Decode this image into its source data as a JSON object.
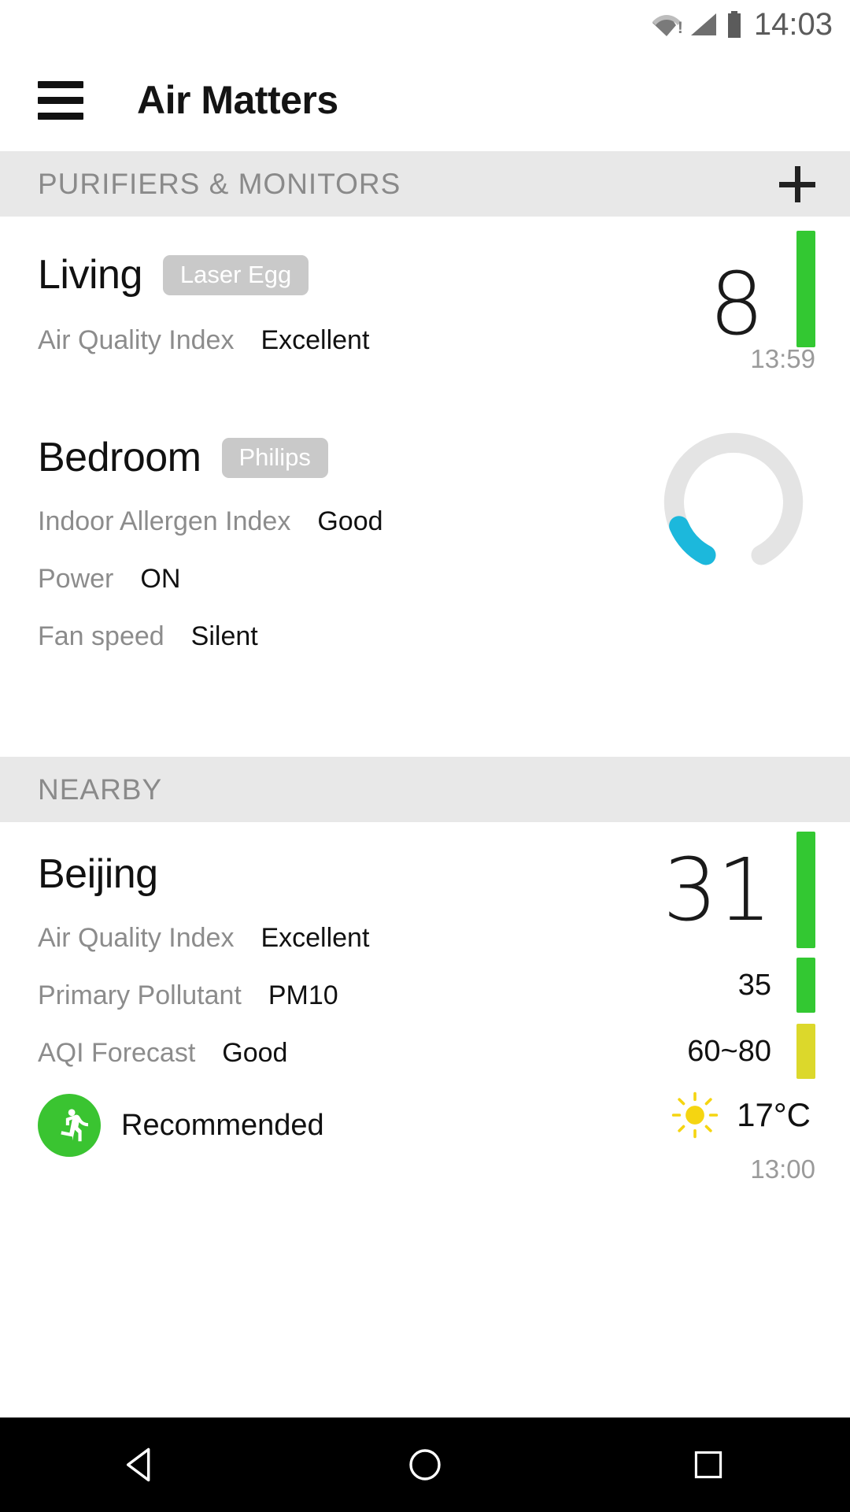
{
  "statusbar": {
    "clock": "14:03",
    "wifi_icon": "wifi-no-internet-icon",
    "signal_icon": "cellular-signal-icon",
    "battery_icon": "battery-icon",
    "wifi_alert": "!"
  },
  "appbar": {
    "menu_icon": "hamburger-menu-icon",
    "title": "Air Matters"
  },
  "sections": {
    "purifiers": {
      "title": "PURIFIERS & MONITORS",
      "add_icon": "plus-icon"
    },
    "nearby": {
      "title": "NEARBY"
    }
  },
  "devices": [
    {
      "name": "Living",
      "badge": "Laser Egg",
      "metric_label": "Air Quality Index",
      "metric_value": "Excellent",
      "index_value": "8",
      "index_color": "#33c832",
      "timestamp": "13:59"
    },
    {
      "name": "Bedroom",
      "badge": "Philips",
      "metric_label": "Indoor Allergen Index",
      "metric_value": "Good",
      "power_label": "Power",
      "power_value": "ON",
      "fan_label": "Fan speed",
      "fan_value": "Silent",
      "gauge_icon": "allergen-gauge-icon",
      "gauge_track_color": "#e4e4e4",
      "gauge_value_color": "#1cb8dc"
    }
  ],
  "nearby": {
    "city": "Beijing",
    "aqi_label": "Air Quality Index",
    "aqi_value": "Excellent",
    "aqi_number": "31",
    "aqi_color": "#33c832",
    "pollutant_label": "Primary Pollutant",
    "pollutant_value": "PM10",
    "pollutant_number": "35",
    "pollutant_color": "#33c832",
    "forecast_label": "AQI Forecast",
    "forecast_value": "Good",
    "forecast_number": "60~80",
    "forecast_color": "#dcd82b",
    "activity_icon": "running-person-icon",
    "activity_text": "Recommended",
    "activity_color": "#3ac431",
    "weather_icon": "sunny-icon",
    "weather_color": "#f5d511",
    "temperature": "17°C",
    "timestamp": "13:00"
  },
  "navbar": {
    "back_icon": "back-triangle-icon",
    "home_icon": "home-circle-icon",
    "recents_icon": "recents-square-icon"
  }
}
